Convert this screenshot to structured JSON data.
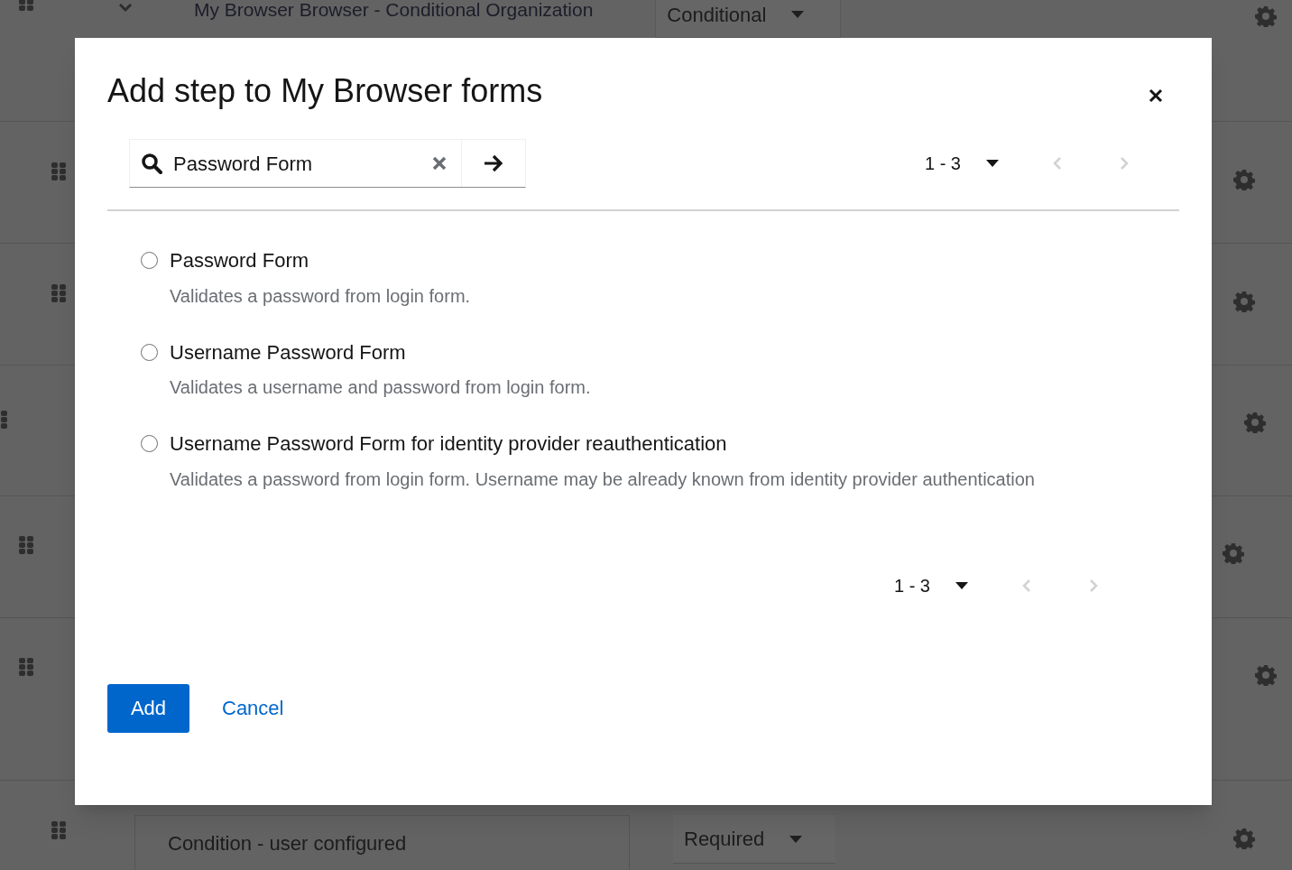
{
  "background": {
    "header_row": {
      "title": "My Browser Browser - Conditional Organization",
      "requirement": "Conditional"
    },
    "last_row": {
      "name": "Condition - user configured",
      "requirement": "Required"
    }
  },
  "dialog": {
    "title": "Add step to My Browser forms",
    "search": {
      "value": "Password Form"
    },
    "pagination_top": {
      "range": "1 - 3",
      "prev_disabled": true,
      "next_disabled": true
    },
    "options": [
      {
        "label": "Password Form",
        "description": "Validates a password from login form.",
        "selected": false
      },
      {
        "label": "Username Password Form",
        "description": "Validates a username and password from login form.",
        "selected": false
      },
      {
        "label": "Username Password Form for identity provider reauthentication",
        "description": "Validates a password from login form. Username may be already known from identity provider authentication",
        "selected": false
      }
    ],
    "pagination_bottom": {
      "range": "1 - 3",
      "prev_disabled": true,
      "next_disabled": true
    },
    "buttons": {
      "primary": "Add",
      "secondary": "Cancel"
    }
  }
}
